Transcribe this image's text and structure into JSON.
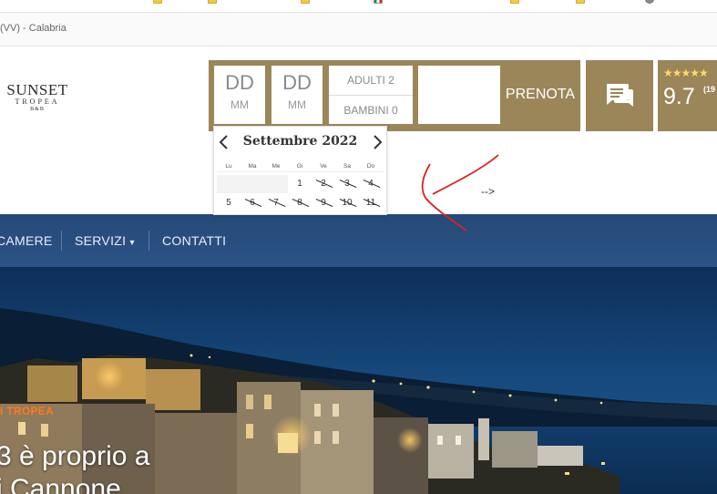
{
  "breadcrumb": {
    "text": "(VV) - Calabria"
  },
  "logo": {
    "line1": "SUNSET",
    "line2": "TROPEA",
    "line3": "B&B"
  },
  "booking": {
    "checkin": {
      "day": "DD",
      "month": "MM"
    },
    "checkout": {
      "day": "DD",
      "month": "MM"
    },
    "adults": "ADULTI 2",
    "children": "BAMBINI 0",
    "submit_label": "PRENOTA"
  },
  "rating": {
    "stars": "★★★★★",
    "score": "9.7",
    "count": "(19"
  },
  "calendar": {
    "title": "Settembre 2022",
    "weekdays": [
      "Lu",
      "Ma",
      "Me",
      "Gi",
      "Ve",
      "Sa",
      "Do"
    ],
    "week1": [
      "",
      "",
      "",
      "1",
      "2",
      "3",
      "4"
    ],
    "week2": [
      "5",
      "6",
      "7",
      "8",
      "9",
      "10",
      "11"
    ]
  },
  "annotation": {
    "text": "-->"
  },
  "nav": {
    "items": [
      "CAMERE",
      "SERVIZI",
      "CONTATTI"
    ],
    "dropdown_caret": "▾"
  },
  "hero": {
    "kicker": "I TROPEA",
    "title_line1": "3 è proprio a",
    "title_line2": "i Cannone"
  },
  "colors": {
    "gold": "#9b8659",
    "navbar": "#2c5386",
    "kicker": "#ff7a1a"
  }
}
